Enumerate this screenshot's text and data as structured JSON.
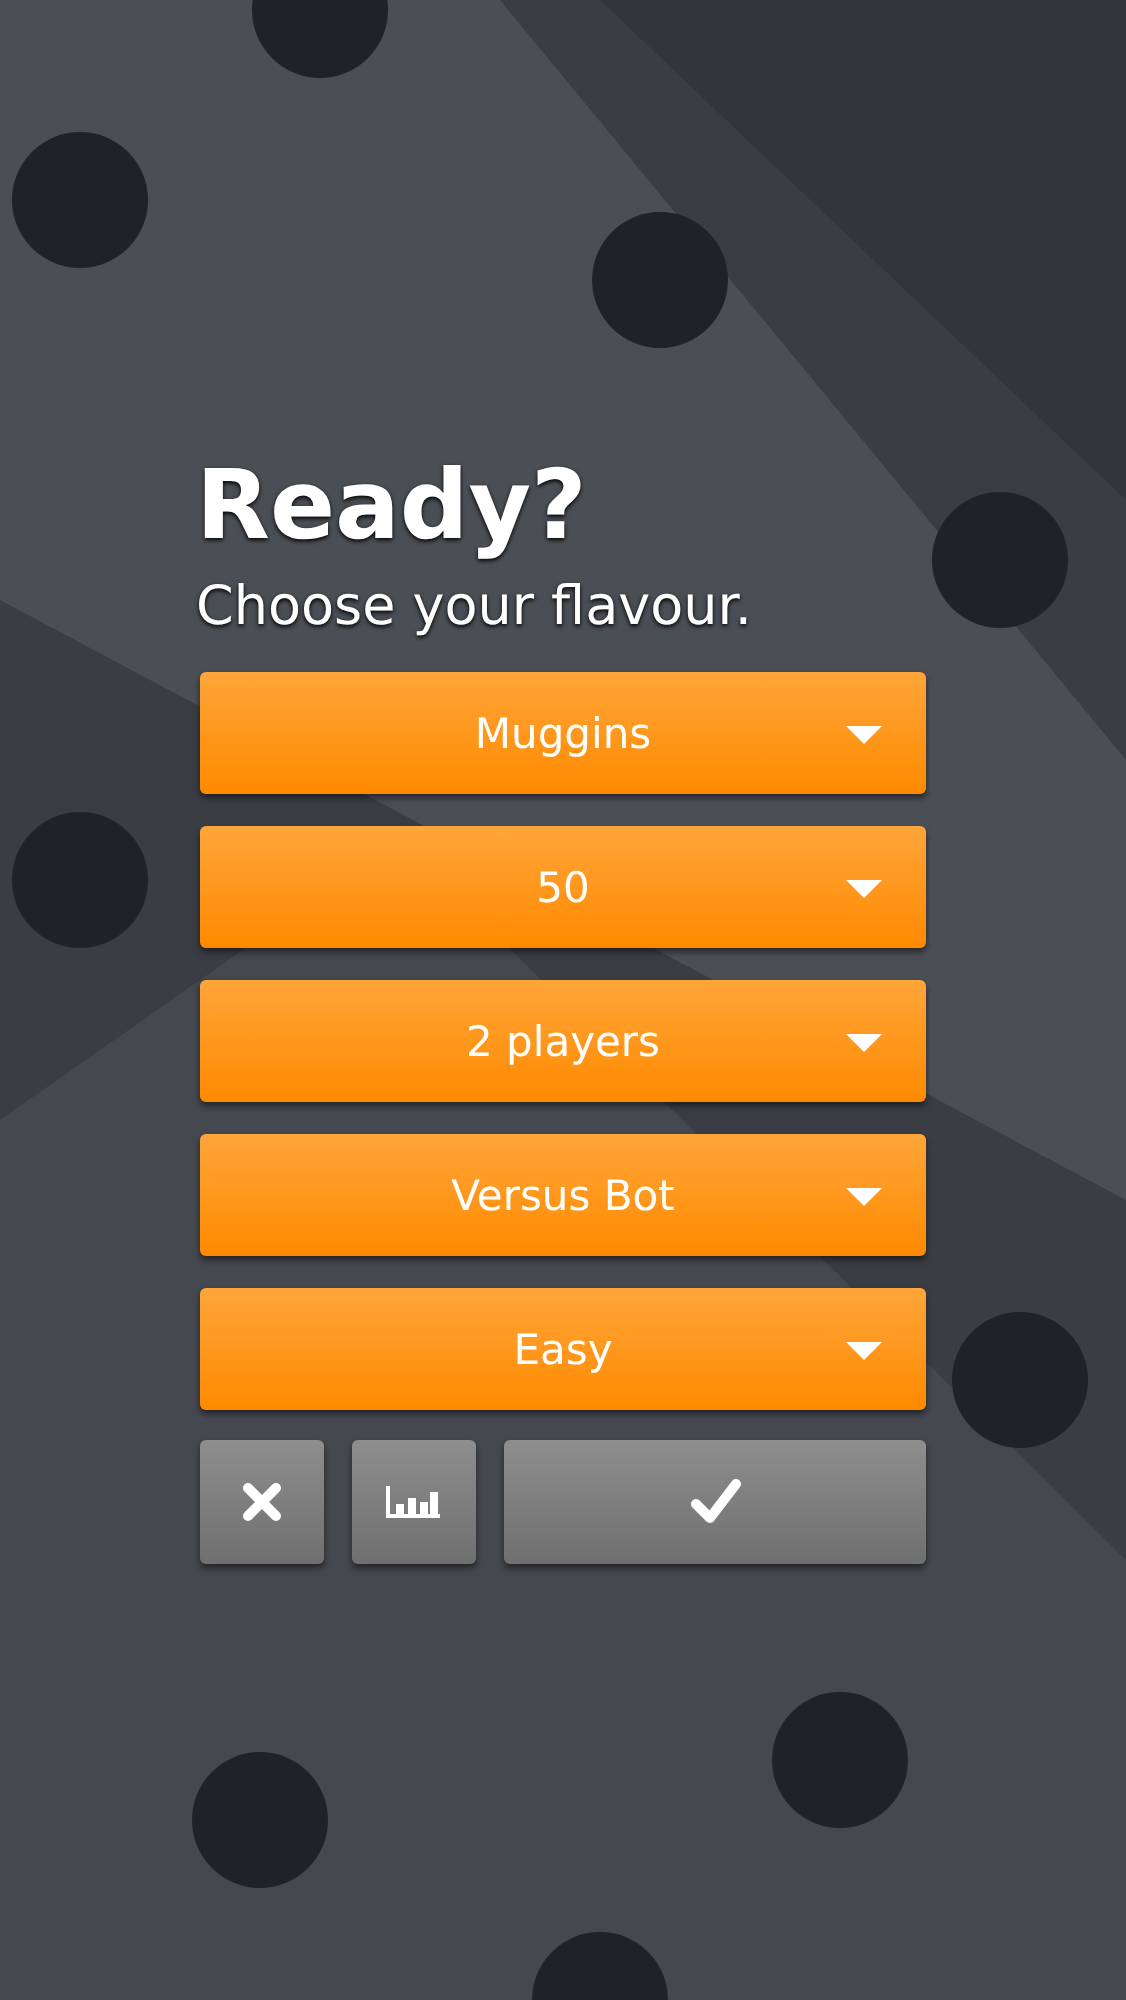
{
  "title": "Ready?",
  "subtitle": "Choose your flavour.",
  "dropdowns": [
    {
      "value": "Muggins"
    },
    {
      "value": "50"
    },
    {
      "value": "2 players"
    },
    {
      "value": "Versus Bot"
    },
    {
      "value": "Easy"
    }
  ],
  "actions": [
    {
      "kind": "cancel"
    },
    {
      "kind": "stats"
    },
    {
      "kind": "confirm"
    }
  ]
}
